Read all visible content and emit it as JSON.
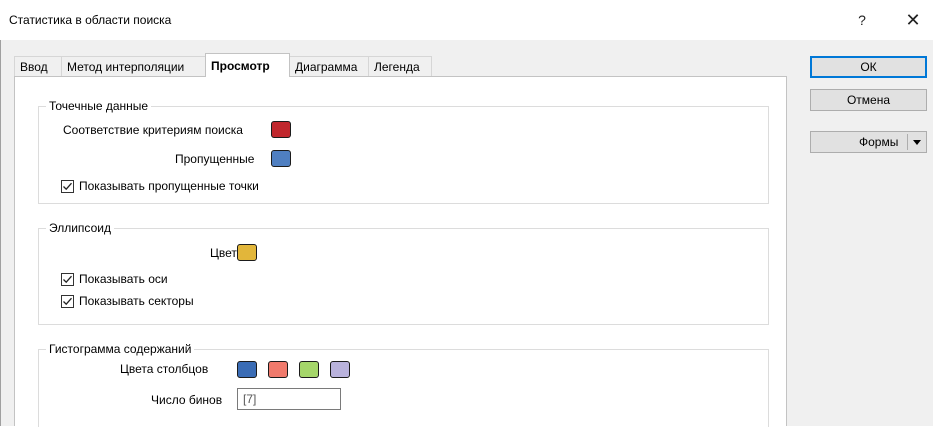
{
  "window": {
    "title": "Статистика в области поиска",
    "help_label": "?",
    "close_label": "✕"
  },
  "tabs": [
    {
      "label": "Ввод"
    },
    {
      "label": "Метод интерполяции"
    },
    {
      "label": "Просмотр"
    },
    {
      "label": "Диаграмма"
    },
    {
      "label": "Легенда"
    }
  ],
  "active_tab": "Просмотр",
  "points_group": {
    "title": "Точечные данные",
    "match_label": "Соответствие критериям поиска",
    "match_color": "#c0272d",
    "missing_label": "Пропущенные",
    "missing_color": "#4f7fc1",
    "show_missing_label": "Показывать пропущенные точки",
    "show_missing_checked": true
  },
  "ellipsoid_group": {
    "title": "Эллипсоид",
    "color_label": "Цвет",
    "color": "#e2b63a",
    "show_axes_label": "Показывать оси",
    "show_axes_checked": true,
    "show_sectors_label": "Показывать секторы",
    "show_sectors_checked": true
  },
  "histogram_group": {
    "title": "Гистограмма содержаний",
    "bar_colors_label": "Цвета столбцов",
    "bar_colors": [
      "#3a6cb5",
      "#f07a6c",
      "#a5d66a",
      "#b9b2dc"
    ],
    "bins_label": "Число бинов",
    "bins_placeholder": "[7]"
  },
  "buttons": {
    "ok": "ОК",
    "cancel": "Отмена",
    "forms": "Формы"
  }
}
